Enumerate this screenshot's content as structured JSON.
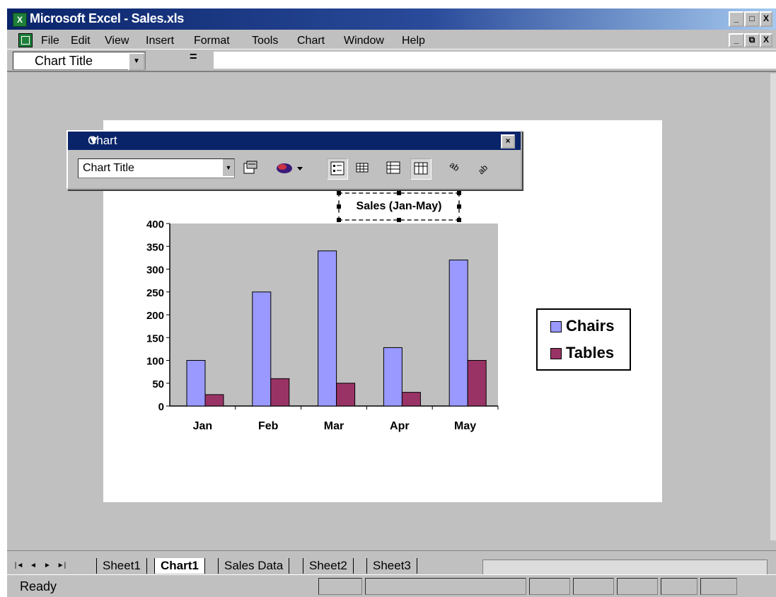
{
  "window": {
    "title": "Microsoft Excel - Sales.xls",
    "app_icon": "X"
  },
  "caption_buttons": {
    "minimize": "_",
    "maximize": "□",
    "close": "X"
  },
  "doc_buttons": {
    "minimize": "_",
    "restore": "⧉",
    "close": "X"
  },
  "menu": [
    "File",
    "Edit",
    "View",
    "Insert",
    "Format",
    "Tools",
    "Chart",
    "Window",
    "Help"
  ],
  "formula_bar": {
    "name_box": "Chart Title",
    "equals": "="
  },
  "chart_toolbar": {
    "title": "Chart",
    "object_selector": "Chart Title",
    "icons": [
      "format-selected-object-icon",
      "chart-type-icon",
      "legend-icon",
      "data-table-icon",
      "by-row-icon",
      "by-column-icon",
      "angle-text-downward-icon",
      "angle-text-upward-icon"
    ]
  },
  "chart_data": {
    "type": "bar",
    "title": "Sales (Jan-May)",
    "categories": [
      "Jan",
      "Feb",
      "Mar",
      "Apr",
      "May"
    ],
    "series": [
      {
        "name": "Chairs",
        "values": [
          100,
          250,
          340,
          128,
          320
        ],
        "color": "#9999ff"
      },
      {
        "name": "Tables",
        "values": [
          25,
          60,
          50,
          30,
          100
        ],
        "color": "#993366"
      }
    ],
    "ylim": [
      0,
      400
    ],
    "yticks": [
      "0",
      "50",
      "100",
      "150",
      "200",
      "250",
      "300",
      "350",
      "400"
    ],
    "grid": false,
    "plot_background": "#c0c0c0",
    "legend_placement": "right"
  },
  "sheet_tabs": [
    "Sheet1",
    "Chart1",
    "Sales Data",
    "Sheet2",
    "Sheet3"
  ],
  "active_tab": "Chart1",
  "nav_buttons": [
    "|◄",
    "◄",
    "►",
    "►|"
  ],
  "status": {
    "text": "Ready"
  }
}
